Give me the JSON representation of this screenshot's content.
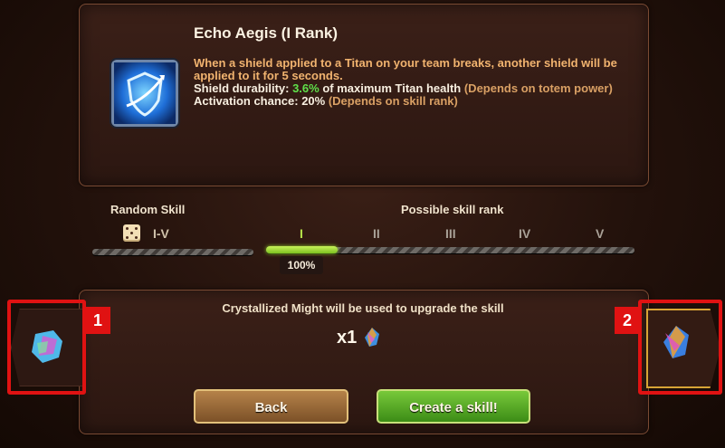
{
  "skill": {
    "title": "Echo Aegis (I Rank)",
    "desc_line1": "When a shield applied to a Titan on your team breaks, another shield will be applied to it for 5 seconds.",
    "durability_label": "Shield durability: ",
    "durability_value": "3.6%",
    "durability_suffix": " of maximum Titan health",
    "durability_note": " (Depends on totem power)",
    "chance_label": "Activation chance: 20%",
    "chance_note": " (Depends on skill rank)",
    "icon": "shield-icon"
  },
  "random_skill": {
    "label": "Random Skill",
    "range": "I-V",
    "icon": "dice-icon"
  },
  "rank": {
    "label": "Possible skill rank",
    "ranks": [
      "I",
      "II",
      "III",
      "IV",
      "V"
    ],
    "active_index": 0,
    "probability_text": "100%",
    "probability": 1.0
  },
  "upgrade": {
    "text": "Crystallized Might will be used to upgrade the skill",
    "quantity": "x1",
    "item_icon": "crystallized-might-icon"
  },
  "annotations": {
    "left_marker": "1",
    "right_marker": "2"
  },
  "buttons": {
    "back": "Back",
    "create": "Create a skill!"
  },
  "colors": {
    "active_rank": "#b6e24a",
    "highlight_green": "#5fe04a",
    "annotation_red": "#e01212",
    "gold_border": "#d7a436"
  }
}
